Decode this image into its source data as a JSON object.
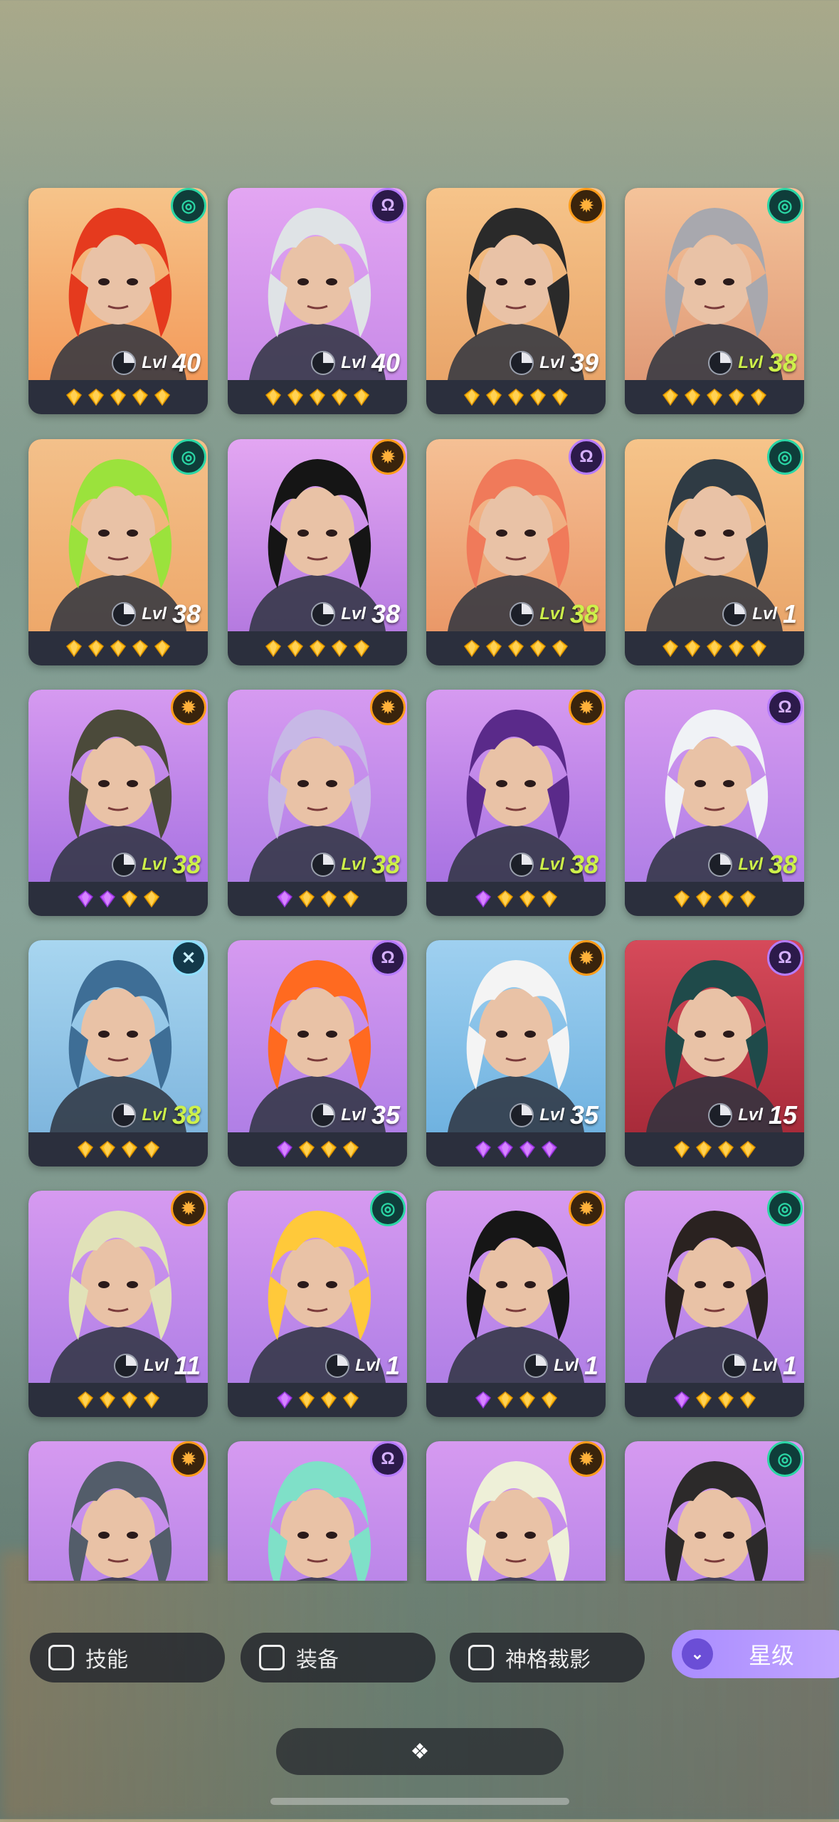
{
  "colors": {
    "badge_green": "#2bd6a5",
    "badge_orange": "#ff9c1a",
    "badge_purple": "#b67cff",
    "level_lime": "#cdf04a",
    "gem_gold": "#ffc21c",
    "gem_purple": "#c85cff"
  },
  "level_prefix": "Lvl",
  "heroes": [
    {
      "level": "40",
      "badge": "green",
      "badge_glyph": "◎",
      "bg": [
        "#f6c48a",
        "#f39a5a"
      ],
      "hair": "#e53a1e",
      "lime": false,
      "gems": [
        "g",
        "g",
        "g",
        "g",
        "g"
      ]
    },
    {
      "level": "40",
      "badge": "purple",
      "badge_glyph": "Ω",
      "bg": [
        "#e3a6f2",
        "#c88ae8"
      ],
      "hair": "#dfe3e6",
      "lime": false,
      "gems": [
        "g",
        "g",
        "g",
        "g",
        "g"
      ]
    },
    {
      "level": "39",
      "badge": "orange",
      "badge_glyph": "✹",
      "bg": [
        "#f6c48a",
        "#e9a56a"
      ],
      "hair": "#2a2a2a",
      "lime": false,
      "gems": [
        "g",
        "g",
        "g",
        "g",
        "g"
      ]
    },
    {
      "level": "38",
      "badge": "green",
      "badge_glyph": "◎",
      "bg": [
        "#f4c39a",
        "#e09a77"
      ],
      "hair": "#a8a8ae",
      "lime": true,
      "gems": [
        "g",
        "g",
        "g",
        "g",
        "g"
      ]
    },
    {
      "level": "38",
      "badge": "green",
      "badge_glyph": "◎",
      "bg": [
        "#f3c08a",
        "#eea86a"
      ],
      "hair": "#9be23c",
      "lime": false,
      "gems": [
        "g",
        "g",
        "g",
        "g",
        "g"
      ]
    },
    {
      "level": "38",
      "badge": "orange",
      "badge_glyph": "✹",
      "bg": [
        "#e3a6f2",
        "#b57ae0"
      ],
      "hair": "#151515",
      "lime": false,
      "gems": [
        "g",
        "g",
        "g",
        "g",
        "g"
      ]
    },
    {
      "level": "38",
      "badge": "purple",
      "badge_glyph": "Ω",
      "bg": [
        "#f5c095",
        "#ea9868"
      ],
      "hair": "#f07a5a",
      "lime": true,
      "gems": [
        "g",
        "g",
        "g",
        "g",
        "g"
      ]
    },
    {
      "level": "1",
      "badge": "green",
      "badge_glyph": "◎",
      "bg": [
        "#f6c48a",
        "#e9a56a"
      ],
      "hair": "#2f3b44",
      "lime": false,
      "gems": [
        "g",
        "g",
        "g",
        "g",
        "g"
      ]
    },
    {
      "level": "38",
      "badge": "orange",
      "badge_glyph": "✹",
      "bg": [
        "#d69af0",
        "#a873e2"
      ],
      "hair": "#4b4a3a",
      "lime": true,
      "gems": [
        "p",
        "p",
        "g",
        "g"
      ]
    },
    {
      "level": "38",
      "badge": "orange",
      "badge_glyph": "✹",
      "bg": [
        "#d69af0",
        "#b07fe6"
      ],
      "hair": "#c7b8e6",
      "lime": true,
      "gems": [
        "p",
        "g",
        "g",
        "g"
      ]
    },
    {
      "level": "38",
      "badge": "orange",
      "badge_glyph": "✹",
      "bg": [
        "#d69af0",
        "#a873e2"
      ],
      "hair": "#5a2a8a",
      "lime": true,
      "gems": [
        "p",
        "g",
        "g",
        "g"
      ]
    },
    {
      "level": "38",
      "badge": "purple",
      "badge_glyph": "Ω",
      "bg": [
        "#d69af0",
        "#b07fe6"
      ],
      "hair": "#f0f2f6",
      "lime": true,
      "gems": [
        "g",
        "g",
        "g",
        "g"
      ]
    },
    {
      "level": "38",
      "badge": "cyan",
      "badge_glyph": "✕",
      "bg": [
        "#a8d6f0",
        "#7fb6de"
      ],
      "hair": "#3e6e96",
      "lime": true,
      "gems": [
        "g",
        "g",
        "g",
        "g"
      ]
    },
    {
      "level": "35",
      "badge": "purple",
      "badge_glyph": "Ω",
      "bg": [
        "#d69af0",
        "#b07fe6"
      ],
      "hair": "#ff6a20",
      "lime": false,
      "gems": [
        "p",
        "g",
        "g",
        "g"
      ]
    },
    {
      "level": "35",
      "badge": "orange",
      "badge_glyph": "✹",
      "bg": [
        "#9fd0f0",
        "#6fb2e0"
      ],
      "hair": "#f4f4f4",
      "lime": false,
      "gems": [
        "p",
        "p",
        "p",
        "p"
      ]
    },
    {
      "level": "15",
      "badge": "purple",
      "badge_glyph": "Ω",
      "bg": [
        "#d64a5a",
        "#a82b3a"
      ],
      "hair": "#1f4a4a",
      "lime": false,
      "gems": [
        "g",
        "g",
        "g",
        "g"
      ]
    },
    {
      "level": "11",
      "badge": "orange",
      "badge_glyph": "✹",
      "bg": [
        "#d69af0",
        "#b07fe6"
      ],
      "hair": "#e1e2b8",
      "lime": false,
      "gems": [
        "g",
        "g",
        "g",
        "g"
      ]
    },
    {
      "level": "1",
      "badge": "green",
      "badge_glyph": "◎",
      "bg": [
        "#d69af0",
        "#b07fe6"
      ],
      "hair": "#ffc93a",
      "lime": false,
      "gems": [
        "p",
        "g",
        "g",
        "g"
      ]
    },
    {
      "level": "1",
      "badge": "orange",
      "badge_glyph": "✹",
      "bg": [
        "#d69af0",
        "#b07fe6"
      ],
      "hair": "#161616",
      "lime": false,
      "gems": [
        "p",
        "g",
        "g",
        "g"
      ]
    },
    {
      "level": "1",
      "badge": "green",
      "badge_glyph": "◎",
      "bg": [
        "#d69af0",
        "#b07fe6"
      ],
      "hair": "#2a2220",
      "lime": false,
      "gems": [
        "p",
        "g",
        "g",
        "g"
      ]
    },
    {
      "level": "",
      "badge": "orange",
      "badge_glyph": "✹",
      "bg": [
        "#d69af0",
        "#b07fe6"
      ],
      "hair": "#535d6a",
      "lime": false,
      "gems": []
    },
    {
      "level": "",
      "badge": "purple",
      "badge_glyph": "Ω",
      "bg": [
        "#d69af0",
        "#b07fe6"
      ],
      "hair": "#7fe0c8",
      "lime": false,
      "gems": []
    },
    {
      "level": "",
      "badge": "orange",
      "badge_glyph": "✹",
      "bg": [
        "#d69af0",
        "#b07fe6"
      ],
      "hair": "#eef0d8",
      "lime": false,
      "gems": []
    },
    {
      "level": "",
      "badge": "green",
      "badge_glyph": "◎",
      "bg": [
        "#d69af0",
        "#b07fe6"
      ],
      "hair": "#2c2a2a",
      "lime": false,
      "gems": []
    }
  ],
  "filters": {
    "skill_label": "技能",
    "equipment_label": "装备",
    "divine_label": "神格裁影",
    "star_label": "星级"
  },
  "handle_glyph": "❖"
}
